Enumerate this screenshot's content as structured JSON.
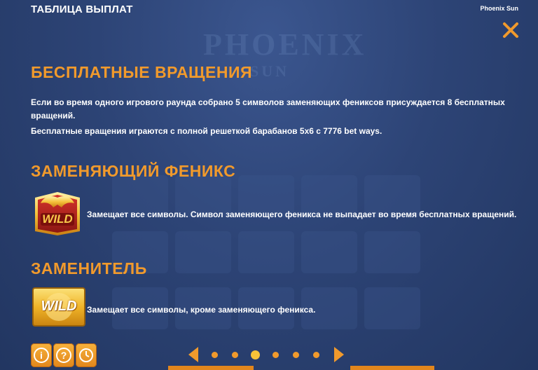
{
  "header": {
    "title": "ТАБЛИЦА ВЫПЛАТ",
    "game_name": "Phoenix Sun"
  },
  "background": {
    "logo_text": "PHOENIX",
    "logo_sub": "SUN"
  },
  "sections": {
    "free_spins": {
      "title": "БЕСПЛАТНЫЕ ВРАЩЕНИЯ",
      "line1": "Если во время одного игрового раунда собрано 5 символов заменяющих фениксов присуждается 8 бесплатных",
      "line2": "вращений.",
      "line3": "Бесплатные вращения играются с полной решеткой барабанов 5x6 с 7776 bet ways."
    },
    "phoenix_wild": {
      "title": "ЗАМЕНЯЮЩИЙ ФЕНИКС",
      "symbol_label": "WILD",
      "description": "Замещает все символы. Символ заменяющего феникса не выпадает во время бесплатных вращений."
    },
    "wild": {
      "title": "ЗАМЕНИТЕЛЬ",
      "symbol_label": "WILD",
      "description": "Замещает все символы, кроме заменяющего феникса."
    }
  },
  "footer": {
    "info_glyph": "i",
    "help_glyph": "?",
    "pages_total": 6,
    "active_page": 3
  },
  "colors": {
    "accent": "#f19a2c",
    "background": "#2a3f6e",
    "text": "#ffffff"
  },
  "icons": [
    "close-icon",
    "info-icon",
    "help-icon",
    "history-icon",
    "arrow-left-icon",
    "arrow-right-icon"
  ]
}
